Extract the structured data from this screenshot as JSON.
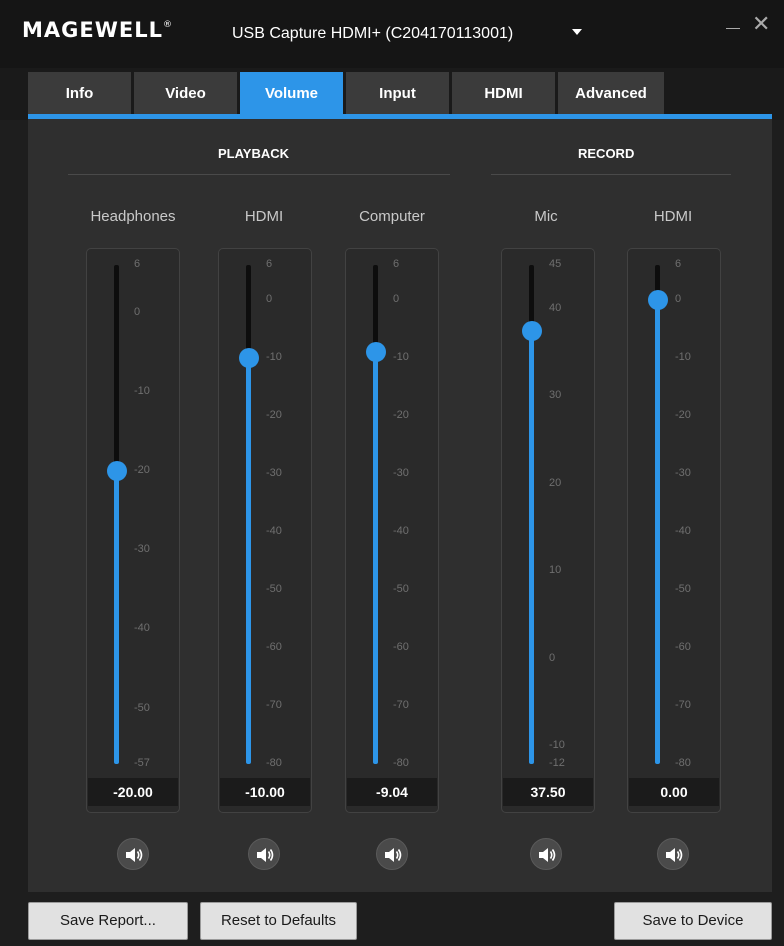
{
  "window": {
    "logo": "MAGEWELL",
    "logo_mark": "®",
    "device_title": "USB Capture HDMI+ (C204170113001)",
    "minimize_symbol": "—",
    "close_symbol": "✕"
  },
  "tabs": [
    {
      "label": "Info",
      "active": false
    },
    {
      "label": "Video",
      "active": false
    },
    {
      "label": "Volume",
      "active": true
    },
    {
      "label": "Input",
      "active": false
    },
    {
      "label": "HDMI",
      "active": false
    },
    {
      "label": "Advanced",
      "active": false
    }
  ],
  "sections": {
    "playback": "PLAYBACK",
    "record": "RECORD"
  },
  "channels": [
    {
      "label": "Headphones",
      "value": "-20.00",
      "level": -20,
      "scale_min": -57,
      "scale_max": 6,
      "ticks": [
        "6",
        "0",
        "-10",
        "-20",
        "-30",
        "-40",
        "-50",
        "-57"
      ]
    },
    {
      "label": "HDMI",
      "value": "-10.00",
      "level": -10,
      "scale_min": -80,
      "scale_max": 6,
      "ticks": [
        "6",
        "0",
        "-10",
        "-20",
        "-30",
        "-40",
        "-50",
        "-60",
        "-70",
        "-80"
      ]
    },
    {
      "label": "Computer",
      "value": "-9.04",
      "level": -9.04,
      "scale_min": -80,
      "scale_max": 6,
      "ticks": [
        "6",
        "0",
        "-10",
        "-20",
        "-30",
        "-40",
        "-50",
        "-60",
        "-70",
        "-80"
      ]
    },
    {
      "label": "Mic",
      "value": "37.50",
      "level": 37.5,
      "scale_min": -12,
      "scale_max": 45,
      "ticks": [
        "45",
        "40",
        "30",
        "20",
        "10",
        "0",
        "-10",
        "-12"
      ]
    },
    {
      "label": "HDMI",
      "value": "0.00",
      "level": 0,
      "scale_min": -80,
      "scale_max": 6,
      "ticks": [
        "6",
        "0",
        "-10",
        "-20",
        "-30",
        "-40",
        "-50",
        "-60",
        "-70",
        "-80"
      ]
    }
  ],
  "footer": {
    "save_report": "Save Report...",
    "reset_defaults": "Reset to Defaults",
    "save_device": "Save to Device"
  },
  "colors": {
    "accent": "#2d95e8",
    "panel": "#2f2f2f",
    "titlebar": "#151515"
  },
  "icons": {
    "speaker": "speaker-icon",
    "dropdown": "chevron-down-icon",
    "minimize": "minimize-icon",
    "close": "close-icon"
  }
}
